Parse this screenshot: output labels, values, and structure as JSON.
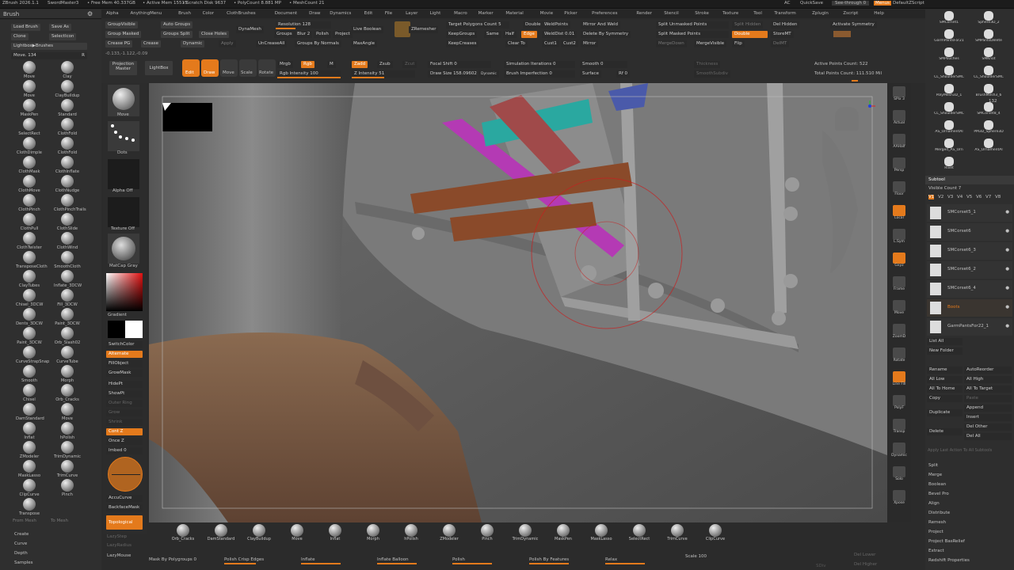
{
  "titlebar": {
    "app": "ZBrush 2026.1.1",
    "user": "SwordMaster3",
    "free_mem": "• Free Mem 40.337GB",
    "active_mem": "• Active Mem 15515",
    "scratch": "• Scratch Disk 9637",
    "polycount": "• PolyCount 8.881 MP",
    "meshcount": "• MeshCount 21",
    "ac": "AC",
    "quicksave": "QuickSave",
    "seethrough": "See-through 0",
    "menus": "Menus",
    "script": "DefaultZScript"
  },
  "menubar": [
    "Alpha",
    "AnythingMenu",
    "Brush",
    "Color",
    "ClothBrushes",
    "Document",
    "Draw",
    "Dynamics",
    "Edit",
    "File",
    "Layer",
    "Light",
    "Macro",
    "Marker",
    "Material",
    "Movie",
    "Picker",
    "Preferences",
    "Render",
    "Stencil",
    "Stroke",
    "Texture",
    "Tool",
    "Transform",
    "Zplugin",
    "Zscript",
    "Help"
  ],
  "brush_header": "Brush",
  "left_top": {
    "load_brush": "Load Brush",
    "save_as": "Save As",
    "clone": "Clone",
    "select_icon": "SelectIcon",
    "lightbox": "Lightbox▶Brushes",
    "move_label": "Move. 134",
    "r_label": "R"
  },
  "brushes": [
    [
      "Move",
      "Clay"
    ],
    [
      "Move",
      "ClayBuildup"
    ],
    [
      "MaskPen",
      "Standard"
    ],
    [
      "SelectRect",
      "ClothFold"
    ],
    [
      "ClothDimple",
      "ClothFold"
    ],
    [
      "ClothMask",
      "ClothInflate"
    ],
    [
      "ClothMove",
      "ClothNudge"
    ],
    [
      "ClothPinch",
      "ClothPinchTrails"
    ],
    [
      "ClothPull",
      "ClothSlide"
    ],
    [
      "ClothTwister",
      "ClothWind"
    ],
    [
      "TransposeCloth",
      "SmoothCloth"
    ],
    [
      "ClayTubes",
      "Inflate_3DCW"
    ],
    [
      "Chisel_3DCW",
      "Fill_3DCW"
    ],
    [
      "Dents_3DCW",
      "Paint_3DCW"
    ],
    [
      "Paint_3DCW",
      "Orb_Slash02"
    ],
    [
      "CurveStrapSnap",
      "CurveTube"
    ],
    [
      "Smooth",
      "Morph"
    ],
    [
      "Chisel",
      "Orb_Cracks"
    ],
    [
      "DamStandard",
      "Move"
    ],
    [
      "Inflat",
      "hPolish"
    ],
    [
      "ZModeler",
      "TrimDynamic"
    ],
    [
      "MaskLasso",
      "TrimCurve"
    ],
    [
      "ClipCurve",
      "Pinch"
    ],
    [
      "Transpose",
      ""
    ]
  ],
  "from_mesh": "From Mesh",
  "to_mesh": "To Mesh",
  "bottom_left": [
    "Create",
    "Curve",
    "Depth",
    "Samples"
  ],
  "toolbar_row1": {
    "group_visible": "GroupVisible",
    "auto_groups": "Auto Groups",
    "dynamesh": "DynaMesh",
    "resolution": "Resolution 128",
    "live_boolean": "Live Boolean",
    "zremesher": "ZRemesher",
    "target_polycount": "Target Polygons Count 5",
    "double": "Double",
    "weld_points": "WeldPoints",
    "mirror_weld": "Mirror And Weld",
    "split_unmasked": "Split Unmasked Points",
    "split_hidden": "Split Hidden",
    "del_hidden": "Del Hidden",
    "activate_symmetry": "Activate Symmetry"
  },
  "toolbar_row2": {
    "group_masked": "Group Masked",
    "groups_split": "Groups Split",
    "close_holes": "Close Holes",
    "groups": "Groups",
    "blur": "Blur 2",
    "polish": "Polish",
    "project": "Project",
    "keep_groups": "KeepGroups",
    "same": "Same",
    "half": "Half",
    "edge": "Edge",
    "weld_dist": "WeldDist 0.01",
    "delete_by_sym": "Delete By Symmetry",
    "split_masked": "Split Masked Points",
    "double2": "Double",
    "store_mt": "StoreMT"
  },
  "toolbar_row3": {
    "crease_pg": "Crease PG",
    "crease": "Crease",
    "dynamic": "Dynamic",
    "apply": "Apply",
    "uncrease_all": "UnCreaseAll",
    "groups_by_normals": "Groups By Normals",
    "maxangle": "MaxAngle",
    "keep_creases": "KeepCreases",
    "clear_to": "Clear To",
    "cust1": "Cust1",
    "cust2": "Cust2",
    "mirror": "Mirror",
    "merge_down": "MergeDown",
    "merge_visible": "MergeVisible",
    "flip": "Flip",
    "del_mt": "DelMT"
  },
  "coords": "-0.133,-1.122,-0.09",
  "toolbar_row4": {
    "projection_master": "Projection Master",
    "lightbox": "LightBox",
    "edit": "Edit",
    "draw": "Draw",
    "move": "Move",
    "scale": "Scale",
    "rotate": "Rotate",
    "mrgb": "Mrgb",
    "rgb": "Rgb",
    "m": "M",
    "zadd": "Zadd",
    "zsub": "Zsub",
    "zcut": "Zcut",
    "focal_shift": "Focal Shift 0",
    "simulation_iterations": "Simulation Iterations 0",
    "smooth": "Smooth 0",
    "thickness": "Thickness",
    "active_points": "Active Points Count: 522"
  },
  "toolbar_row5": {
    "rgb_intensity": "Rgb Intensity 100",
    "z_intensity": "Z Intensity 51",
    "draw_size": "Draw Size 158.09602",
    "dynamic": "Dynamic",
    "brush_imperfection": "Brush Imperfection 0",
    "surface": "Surface",
    "rf": "Rf 0",
    "smooth_subdiv": "SmoothSubdiv",
    "total_points": "Total Points Count: 111.510 Mil"
  },
  "midstrip": {
    "move": "Move",
    "dots": "Dots",
    "alpha_off": "Alpha Off",
    "texture_off": "Texture Off",
    "matcap": "MatCap Gray",
    "gradient": "Gradient",
    "switch_color": "SwitchColor",
    "alternate": "Alternate",
    "fill_object": "FillObject",
    "grow_mask": "GrowMask",
    "hide_pt": "HidePt",
    "show_pt": "ShowPt",
    "outer_ring": "Outer Ring",
    "grow": "Grow",
    "shrink": "Shrink",
    "cont_z": "Cont Z",
    "once_z": "Once Z",
    "imbed": "Imbed 0",
    "accucurve": "AccuCurve",
    "backface_mask": "BackfaceMask",
    "topological": "Topological",
    "lazy_step": "LazyStep",
    "lazy_radius": "LazyRadius",
    "lazy_mouse": "LazyMouse"
  },
  "rightstrip": [
    "SPix 3",
    "Actual",
    "AAHalf",
    "Persp",
    "Floor",
    "Local",
    "L.Sym",
    "Gxyz",
    "Frame",
    "Move",
    "ZoomD",
    "Rotate",
    "Line Fill",
    "PolyF",
    "Transp",
    "Dynamic",
    "Solo",
    "Xpose"
  ],
  "subtool": {
    "tools": [
      "SMCorset1",
      "Sphere3D_2",
      "GarmPantsFor21",
      "SMPantsDelete",
      "SMPouches",
      "SMKnot",
      "CL_ShoulderSMC",
      "CL_ShoulderSMC",
      "PolyMesh3D_1",
      "BrushMesh3_6",
      "CL_ShoulderSMC",
      "SMCorset8_4",
      "AS_OrnamentAl",
      "PM3D_Sphere3D",
      "Merged_AS_Orn",
      "AS_OrnamentAl",
      "Rivet"
    ],
    "count_132": "132",
    "header": "Subtool",
    "visible_count": "Visible Count 7",
    "versions": [
      "V1",
      "V2",
      "V3",
      "V4",
      "V5",
      "V6",
      "V7",
      "V8"
    ],
    "items": [
      "SMCorset5_1",
      "SMCorset6",
      "SMCorset6_3",
      "SMCorset6_2",
      "SMCorset6_4",
      "Boots",
      "GarmPantsFor22_1"
    ],
    "list_all": "List All",
    "new_folder": "New Folder",
    "rename": "Rename",
    "auto_reorder": "AutoReorder",
    "all_low": "All Low",
    "all_high": "All High",
    "all_to_home": "All To Home",
    "all_to_target": "All To Target",
    "copy": "Copy",
    "paste": "Paste",
    "append": "Append",
    "duplicate": "Duplicate",
    "insert": "Insert",
    "delete": "Delete",
    "del_other": "Del Other",
    "del_all": "Del All",
    "apply_last": "Apply Last Action To All Subtools",
    "split": "Split",
    "merge": "Merge",
    "boolean": "Boolean",
    "bevel_pro": "Bevel Pro",
    "align": "Align",
    "distribute": "Distribute",
    "remesh": "Remesh",
    "project": "Project",
    "project_bas_relief": "Project BasRelief",
    "extract": "Extract",
    "redshift": "Redshift Properties"
  },
  "bottom_brushes": [
    "Orb_Cracks",
    "DamStandard",
    "ClayBuildup",
    "Move",
    "Inflat",
    "Morph",
    "hPolish",
    "ZModeler",
    "Pinch",
    "TrimDynamic",
    "MaskPen",
    "MaskLasso",
    "SelectRect",
    "TrimCurve",
    "ClipCurve"
  ],
  "bottom_sliders": {
    "mask_by_polygroups": "Mask By Polygroups 0",
    "polish_crisp": "Polish Crisp Edges",
    "inflate": "Inflate",
    "inflate_balloon": "Inflate Balloon",
    "polish": "Polish",
    "polish_by_features": "Polish By Features",
    "relax": "Relax",
    "scale": "Scale 100",
    "del_lower": "Del Lower",
    "del_higher": "Del Higher",
    "sdiv": "SDiv"
  },
  "colors": {
    "accent": "#e47a1c",
    "bg": "#2b2b2b",
    "panel": "#2f2f2f"
  }
}
